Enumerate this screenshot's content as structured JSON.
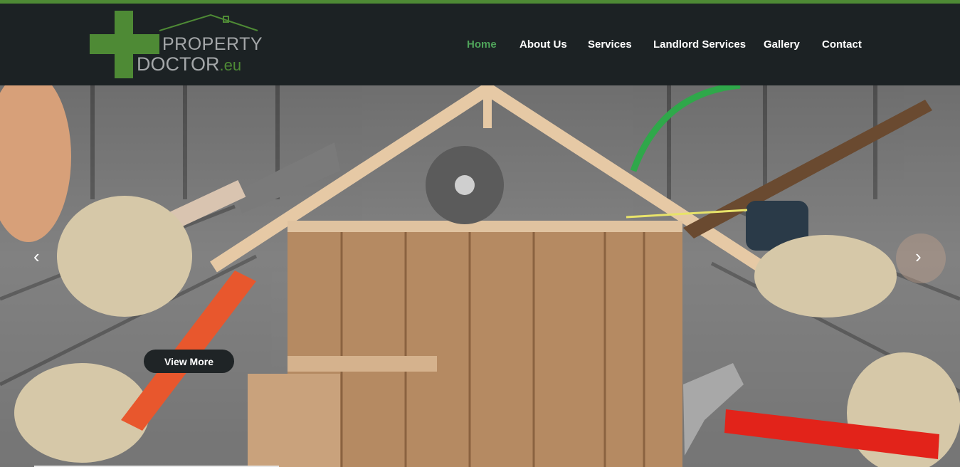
{
  "brand": {
    "line1": "PROPERTY",
    "line2": "DOCTOR",
    "suffix": ".eu",
    "accent_color": "#4e8a35"
  },
  "nav": {
    "items": [
      {
        "label": "Home",
        "active": true
      },
      {
        "label": "About Us",
        "active": false
      },
      {
        "label": "Services",
        "active": false
      },
      {
        "label": "Landlord Services",
        "active": false
      },
      {
        "label": "Gallery",
        "active": false
      },
      {
        "label": "Contact",
        "active": false
      }
    ]
  },
  "slider": {
    "prev_icon": "chevron-left-icon",
    "next_icon": "chevron-right-icon",
    "prev_glyph": "‹",
    "next_glyph": "›",
    "cta_label": "View More"
  }
}
